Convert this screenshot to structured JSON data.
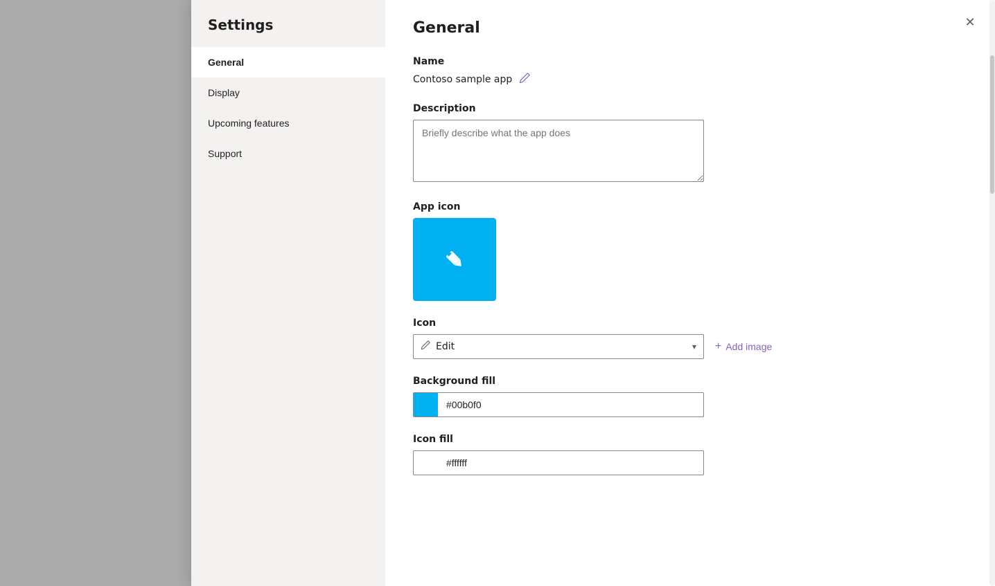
{
  "panel": {
    "title": "Settings",
    "close_label": "✕"
  },
  "sidebar": {
    "title": "Settings",
    "items": [
      {
        "id": "general",
        "label": "General",
        "active": true
      },
      {
        "id": "display",
        "label": "Display",
        "active": false
      },
      {
        "id": "upcoming-features",
        "label": "Upcoming features",
        "active": false
      },
      {
        "id": "support",
        "label": "Support",
        "active": false
      }
    ]
  },
  "main": {
    "title": "General",
    "sections": {
      "name": {
        "label": "Name",
        "value": "Contoso sample app",
        "edit_icon": "✏"
      },
      "description": {
        "label": "Description",
        "placeholder": "Briefly describe what the app does"
      },
      "app_icon": {
        "label": "App icon",
        "background_color": "#00b0f0"
      },
      "icon": {
        "label": "Icon",
        "selected": "Edit",
        "add_image_label": "Add image"
      },
      "background_fill": {
        "label": "Background fill",
        "color": "#00b0f0",
        "value": "#00b0f0"
      },
      "icon_fill": {
        "label": "Icon fill",
        "color": "#ffffff",
        "value": "#ffffff"
      }
    }
  }
}
